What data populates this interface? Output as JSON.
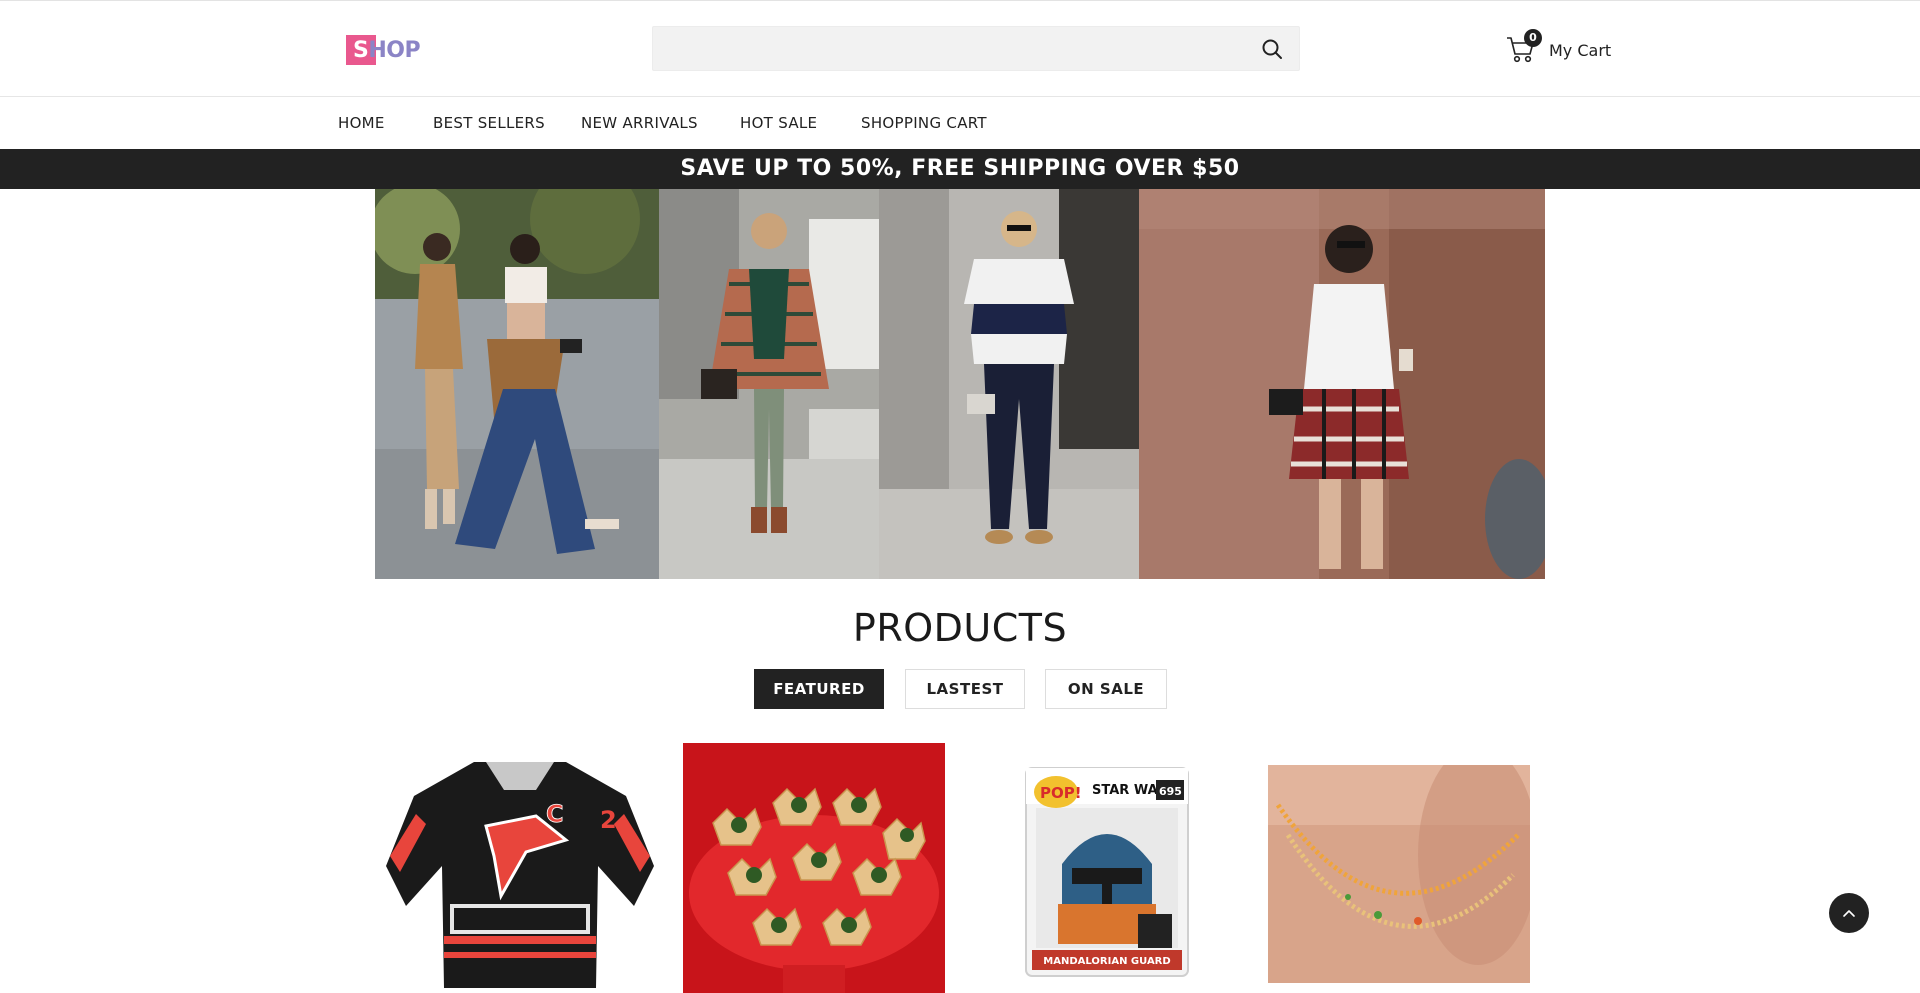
{
  "logo": {
    "first_letter": "S",
    "rest": "HOP"
  },
  "search": {
    "placeholder": "",
    "icon": "search-icon"
  },
  "cart": {
    "count": "0",
    "label": "My Cart",
    "icon": "cart-icon"
  },
  "nav": {
    "items": [
      "HOME",
      "BEST SELLERS",
      "NEW ARRIVALS",
      "HOT SALE",
      "SHOPPING CART"
    ]
  },
  "promo": {
    "text": "SAVE UP TO 50%, FREE SHIPPING OVER $50"
  },
  "hero": {
    "images": [
      "street-style-walking",
      "plaid-scarf-outfit",
      "striped-tee-outfit",
      "flannel-waist-outfit"
    ]
  },
  "products": {
    "title": "PRODUCTS",
    "tabs": [
      "FEATURED",
      "LASTEST",
      "ON SALE"
    ],
    "active_tab": "FEATURED",
    "items": [
      {
        "image": "hockey-jersey",
        "badge_letter": "C",
        "number": "2"
      },
      {
        "image": "spinach-tartlets"
      },
      {
        "image": "funko-pop-box",
        "brand": "POP!",
        "series": "STAR WARS",
        "number": "695",
        "name": "MANDALORIAN GUARD"
      },
      {
        "image": "bead-necklace"
      }
    ]
  },
  "colors": {
    "dark": "#222222",
    "logo_pink": "#e9588e",
    "logo_purple": "#8b84c6"
  },
  "scroll_top": {
    "icon": "chevron-up-icon"
  }
}
